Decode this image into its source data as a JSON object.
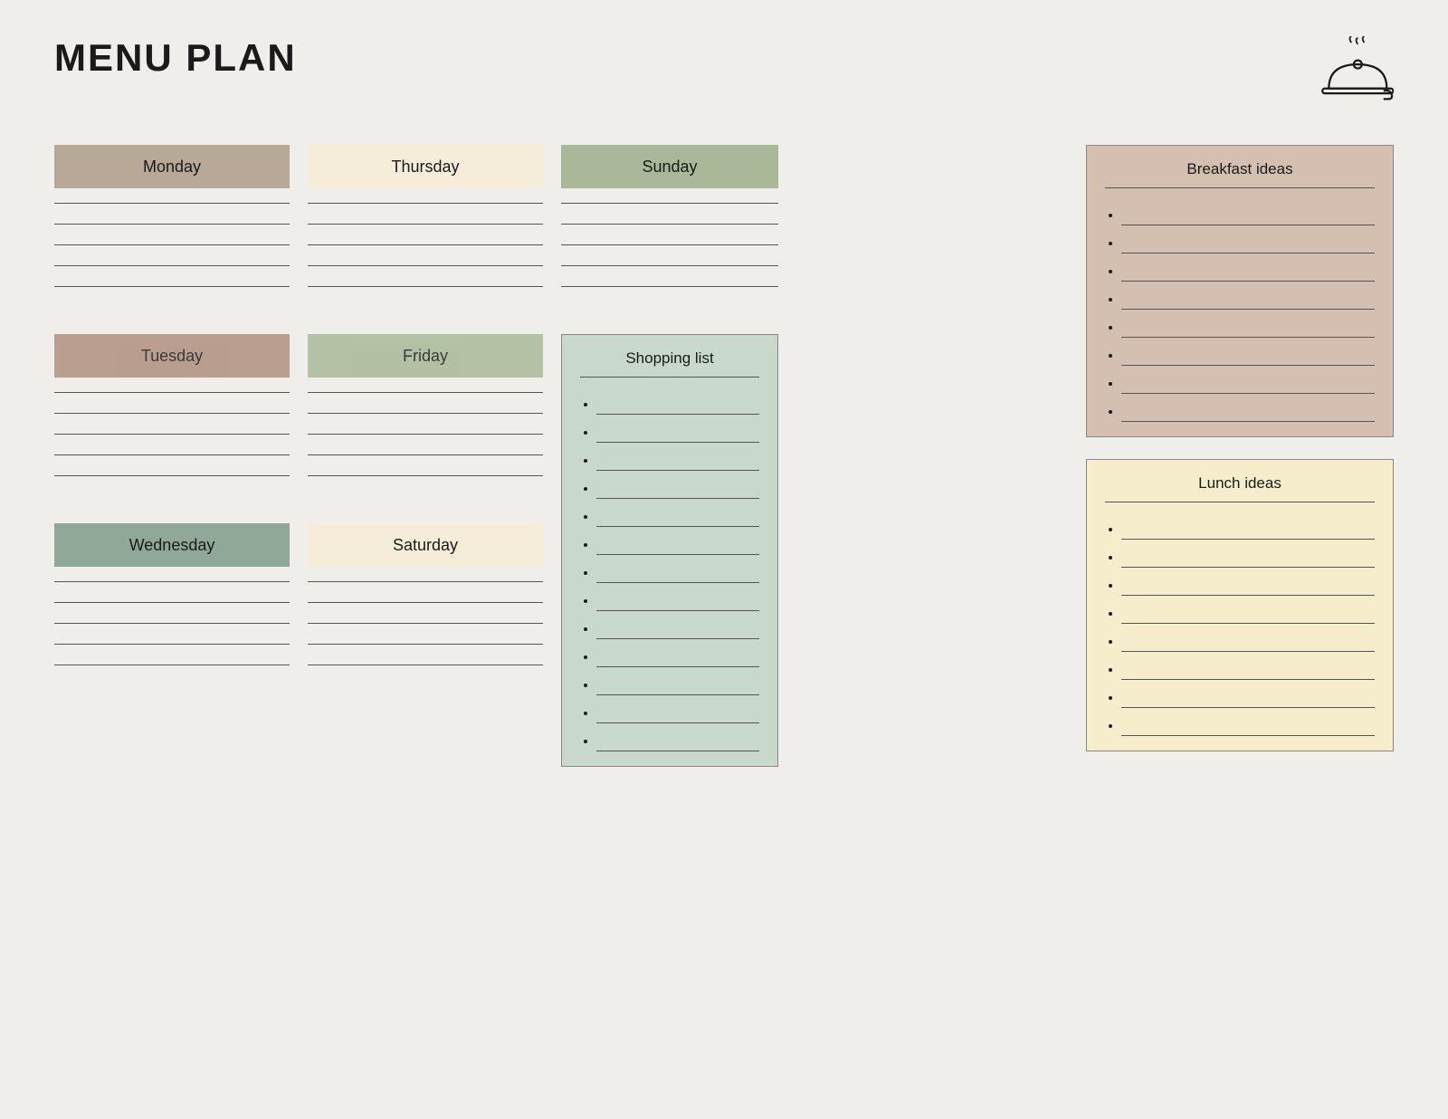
{
  "header": {
    "title": "MENU PLAN"
  },
  "days": {
    "monday": {
      "label": "Monday",
      "colorClass": "monday",
      "lines": 5
    },
    "tuesday": {
      "label": "Tuesday",
      "colorClass": "tuesday",
      "lines": 5
    },
    "wednesday": {
      "label": "Wednesday",
      "colorClass": "wednesday",
      "lines": 5
    },
    "thursday": {
      "label": "Thursday",
      "colorClass": "thursday",
      "lines": 5
    },
    "friday": {
      "label": "Friday",
      "colorClass": "friday",
      "lines": 5
    },
    "saturday": {
      "label": "Saturday",
      "colorClass": "saturday",
      "lines": 5
    },
    "sunday": {
      "label": "Sunday",
      "colorClass": "sunday",
      "lines": 5
    }
  },
  "shopping": {
    "title": "Shopping list",
    "items": 13
  },
  "breakfast": {
    "title": "Breakfast ideas",
    "items": 8
  },
  "lunch": {
    "title": "Lunch ideas",
    "items": 8
  }
}
